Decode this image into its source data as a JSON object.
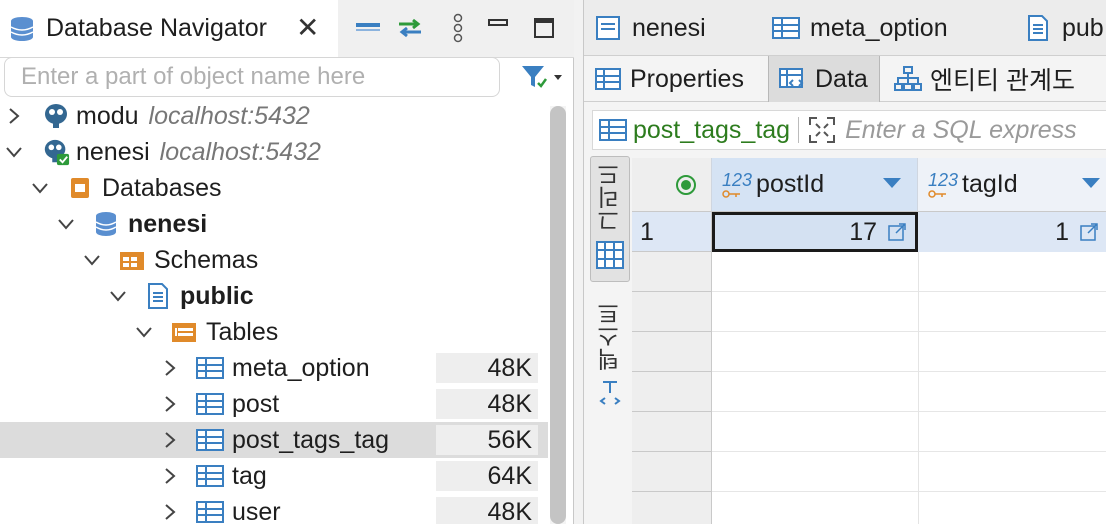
{
  "navigator": {
    "title": "Database Navigator",
    "filter_placeholder": "Enter a part of object name here",
    "tree": [
      {
        "label": "modu",
        "host": "localhost:5432",
        "expanded": false
      },
      {
        "label": "nenesi",
        "host": "localhost:5432",
        "expanded": true
      },
      {
        "label": "Databases",
        "expanded": true
      },
      {
        "label": "nenesi",
        "bold": true,
        "expanded": true
      },
      {
        "label": "Schemas",
        "expanded": true
      },
      {
        "label": "public",
        "bold": true,
        "expanded": true
      },
      {
        "label": "Tables",
        "expanded": true
      },
      {
        "label": "meta_option",
        "size": "48K"
      },
      {
        "label": "post",
        "size": "48K"
      },
      {
        "label": "post_tags_tag",
        "size": "56K",
        "selected": true
      },
      {
        "label": "tag",
        "size": "64K"
      },
      {
        "label": "user",
        "size": "48K"
      }
    ]
  },
  "editor": {
    "tabs": [
      {
        "label": "nenesi"
      },
      {
        "label": "meta_option"
      },
      {
        "label": "pub"
      }
    ],
    "subtabs": [
      {
        "label": "Properties"
      },
      {
        "label": "Data",
        "active": true
      },
      {
        "label": "엔티티 관계도"
      }
    ],
    "filter": {
      "table": "post_tags_tag",
      "placeholder": "Enter a SQL express"
    },
    "side_tabs": [
      {
        "label": "그리드",
        "active": true
      },
      {
        "label": "텍스트"
      }
    ],
    "grid": {
      "type_badge": "123",
      "columns": [
        {
          "name": "postId"
        },
        {
          "name": "tagId"
        }
      ],
      "rows": [
        {
          "num": "1",
          "values": [
            "17",
            "1"
          ]
        }
      ]
    }
  },
  "colors": {
    "accent_blue": "#3a7fc1",
    "tree_selection": "#dcdcdc",
    "table_name_green": "#2d7c1e",
    "folder_orange": "#e08a2a"
  }
}
